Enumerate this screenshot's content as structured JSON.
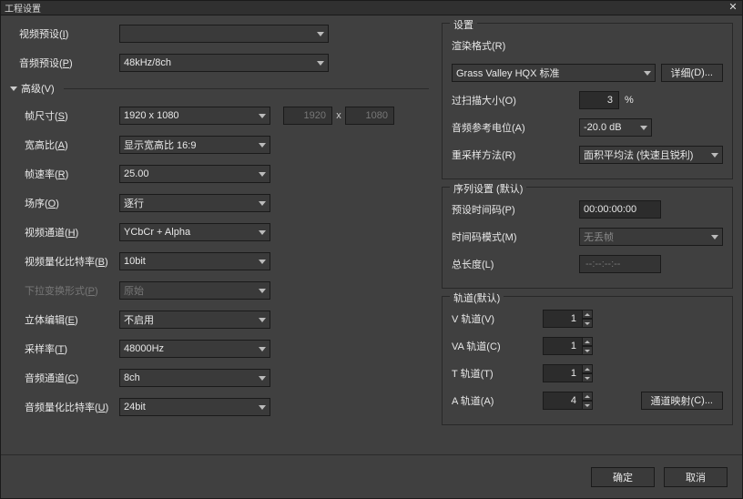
{
  "window": {
    "title": "工程设置"
  },
  "left": {
    "videoPreset": {
      "label_pre": "视频预设(",
      "mn": "I",
      "label_post": ")",
      "value": ""
    },
    "audioPreset": {
      "label_pre": "音频预设(",
      "mn": "P",
      "label_post": ")",
      "value": "48kHz/8ch"
    },
    "advanced": {
      "label_pre": "高级(",
      "mn": "V",
      "label_post": ")"
    },
    "frameSize": {
      "label_pre": "帧尺寸(",
      "mn": "S",
      "label_post": ")",
      "value": "1920 x 1080",
      "w": "1920",
      "h": "1080",
      "x": "x"
    },
    "aspect": {
      "label_pre": "宽高比(",
      "mn": "A",
      "label_post": ")",
      "value": "显示宽高比 16:9"
    },
    "frameRate": {
      "label_pre": "帧速率(",
      "mn": "R",
      "label_post": ")",
      "value": "25.00"
    },
    "fieldOrder": {
      "label_pre": "场序(",
      "mn": "O",
      "label_post": ")",
      "value": "逐行"
    },
    "videoCh": {
      "label_pre": "视频通道(",
      "mn": "H",
      "label_post": ")",
      "value": "YCbCr + Alpha"
    },
    "videoBit": {
      "label_pre": "视频量化比特率(",
      "mn": "B",
      "label_post": ")",
      "value": "10bit"
    },
    "pulldown": {
      "label_pre": "下拉变换形式(",
      "mn": "P",
      "label_post": ")",
      "value": "原始"
    },
    "stereoEdit": {
      "label_pre": "立体编辑(",
      "mn": "E",
      "label_post": ")",
      "value": "不启用"
    },
    "sampleRate": {
      "label_pre": "采样率(",
      "mn": "T",
      "label_post": ")",
      "value": "48000Hz"
    },
    "audioCh": {
      "label_pre": "音频通道(",
      "mn": "C",
      "label_post": ")",
      "value": "8ch"
    },
    "audioBit": {
      "label_pre": "音频量化比特率(",
      "mn": "U",
      "label_post": ")",
      "value": "24bit"
    }
  },
  "settings": {
    "legend": "设置",
    "renderFmt": {
      "label_pre": "渲染格式(",
      "mn": "R",
      "label_post": ")",
      "value": "Grass Valley HQX 标准"
    },
    "detailBtn": {
      "label_pre": "详细(",
      "mn": "D",
      "label_post": ")..."
    },
    "overscan": {
      "label_pre": "过扫描大小(",
      "mn": "O",
      "label_post": ")",
      "value": "3",
      "unit": "%"
    },
    "audioRef": {
      "label_pre": "音频参考电位(",
      "mn": "A",
      "label_post": ")",
      "value": "-20.0 dB"
    },
    "resample": {
      "label_pre": "重采样方法(",
      "mn": "R",
      "label_post": ")",
      "value": "面积平均法 (快速且锐利)"
    }
  },
  "sequence": {
    "legend": "序列设置 (默认)",
    "presetTC": {
      "label_pre": "预设时间码(",
      "mn": "P",
      "label_post": ")",
      "value": "00:00:00:00"
    },
    "tcMode": {
      "label_pre": "时间码模式(",
      "mn": "M",
      "label_post": ")",
      "value": "无丢帧"
    },
    "totalLen": {
      "label_pre": "总长度(",
      "mn": "L",
      "label_post": ")",
      "value": "--:--:--:--"
    }
  },
  "track": {
    "legend": "轨道(默认)",
    "v": {
      "label_pre": "V 轨道(",
      "mn": "V",
      "label_post": ")",
      "value": "1"
    },
    "va": {
      "label_pre": "VA 轨道(",
      "mn": "C",
      "label_post": ")",
      "value": "1"
    },
    "t": {
      "label_pre": "T 轨道(",
      "mn": "T",
      "label_post": ")",
      "value": "1"
    },
    "a": {
      "label_pre": "A 轨道(",
      "mn": "A",
      "label_post": ")",
      "value": "4"
    },
    "chMapBtn": {
      "label_pre": "通道映射(",
      "mn": "C",
      "label_post": ")..."
    }
  },
  "footer": {
    "ok": "确定",
    "cancel": "取消"
  }
}
